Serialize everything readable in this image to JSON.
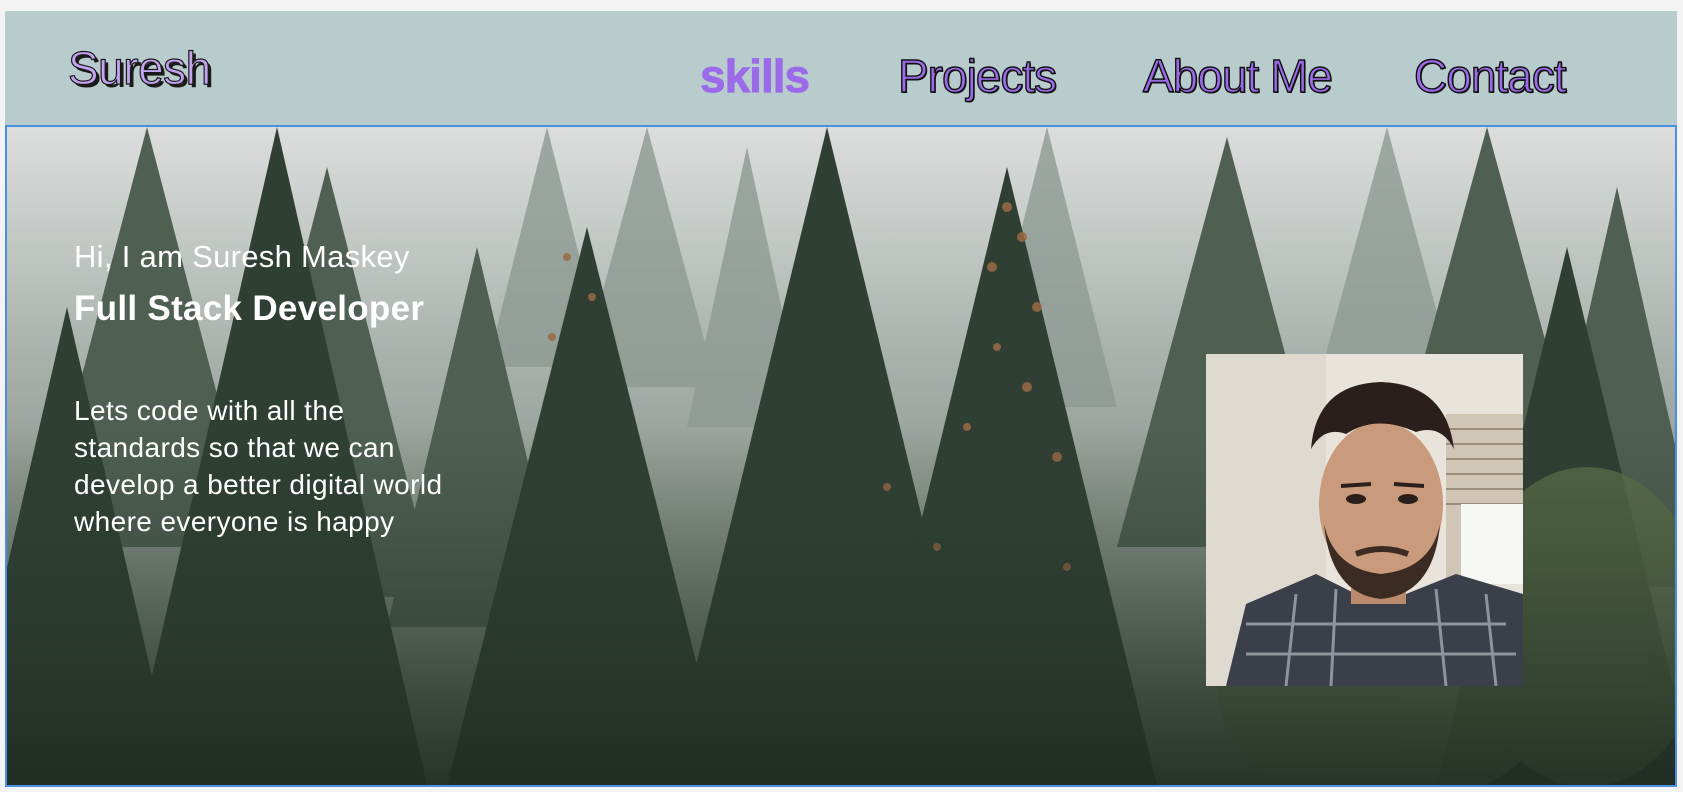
{
  "navbar": {
    "brand": "Suresh",
    "links": [
      {
        "label": "skills",
        "active": true
      },
      {
        "label": "Projects",
        "active": false
      },
      {
        "label": "About Me",
        "active": false
      },
      {
        "label": "Contact",
        "active": false
      }
    ]
  },
  "hero": {
    "greeting": "Hi, I am Suresh Maskey",
    "role": "Full Stack Developer",
    "tagline": "Lets code with all the standards so that we can develop a better digital world where everyone is happy"
  },
  "colors": {
    "navbar_bg": "#b9cccd",
    "accent": "#9b6ae8",
    "selection_border": "#4a90e2"
  },
  "icons": {
    "background": "forest-image",
    "portrait": "profile-photo"
  }
}
